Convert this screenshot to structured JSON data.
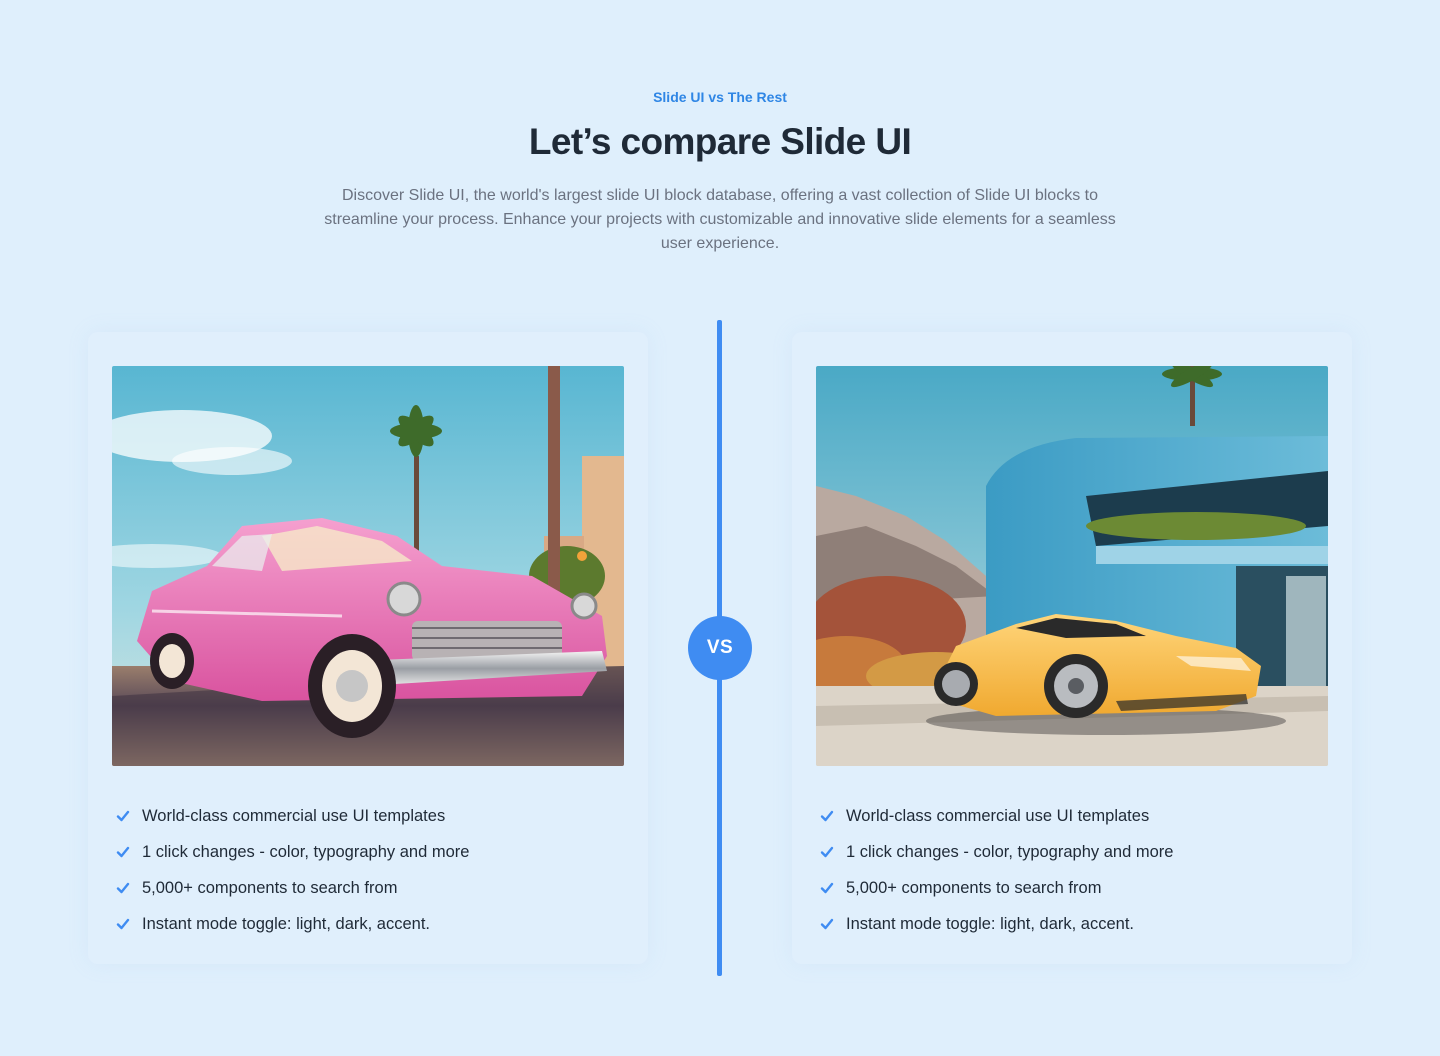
{
  "header": {
    "eyebrow": "Slide UI vs The Rest",
    "title": "Let’s compare Slide UI",
    "description": "Discover Slide UI, the world's largest slide UI block database, offering a vast collection of Slide UI blocks to streamline your process. Enhance your projects with customizable and innovative slide elements for a seamless user experience."
  },
  "vs_label": "VS",
  "colors": {
    "accent": "#3f8cf2",
    "eyebrow": "#2f86e5",
    "background": "#dfeffc",
    "heading": "#1f2a37",
    "body": "#6b7280"
  },
  "cards": [
    {
      "image": "pink-vintage-car-photo",
      "features": [
        "World-class commercial use UI templates",
        "1 click changes - color, typography and more",
        "5,000+ components to search from",
        "Instant mode toggle: light, dark, accent."
      ]
    },
    {
      "image": "yellow-sports-car-photo",
      "features": [
        "World-class commercial use UI templates",
        "1 click changes - color, typography and more",
        "5,000+ components to search from",
        "Instant mode toggle: light, dark, accent."
      ]
    }
  ]
}
